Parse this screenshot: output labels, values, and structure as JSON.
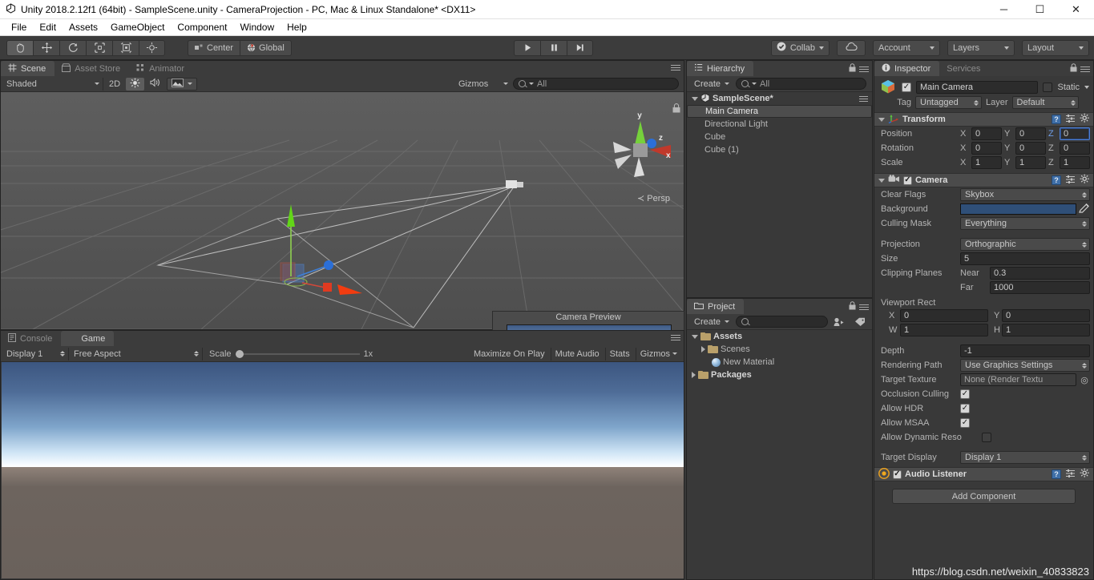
{
  "window": {
    "title": "Unity 2018.2.12f1 (64bit) - SampleScene.unity - CameraProjection - PC, Mac & Linux Standalone* <DX11>",
    "app_icon": "unity-logo-icon",
    "minimize": "─",
    "maximize": "☐",
    "close": "✕"
  },
  "menu": {
    "items": [
      "File",
      "Edit",
      "Assets",
      "GameObject",
      "Component",
      "Window",
      "Help"
    ]
  },
  "toolbar": {
    "transform_tools": [
      {
        "name": "hand-tool",
        "active": true
      },
      {
        "name": "move-tool",
        "active": false
      },
      {
        "name": "rotate-tool",
        "active": false
      },
      {
        "name": "scale-tool",
        "active": false
      },
      {
        "name": "rect-tool",
        "active": false
      },
      {
        "name": "transform-tool",
        "active": false
      }
    ],
    "pivot_label": "Center",
    "handle_label": "Global",
    "play_buttons": [
      {
        "name": "play-button",
        "glyph": "▶"
      },
      {
        "name": "pause-button",
        "glyph": "❙❙"
      },
      {
        "name": "step-button",
        "glyph": "▶❙"
      }
    ],
    "collab_label": "Collab",
    "cloud_icon": "cloud-icon",
    "account_label": "Account",
    "layers_label": "Layers",
    "layout_label": "Layout"
  },
  "scene_view": {
    "tabs": [
      {
        "label": "Scene",
        "icon": "grid-icon",
        "active": true
      },
      {
        "label": "Asset Store",
        "icon": "store-icon",
        "active": false
      },
      {
        "label": "Animator",
        "icon": "animator-icon",
        "active": false
      }
    ],
    "draw_mode": "Shaded",
    "mode_2d": "2D",
    "lighting_icon": "sun-icon",
    "audio_icon": "speaker-icon",
    "fx_icon": "image-icon",
    "gizmos_label": "Gizmos",
    "search_value": "All",
    "gizmo_axes": {
      "x": "x",
      "y": "y",
      "z": "z"
    },
    "projection_label": "Persp",
    "lock_icon": "lock-icon"
  },
  "camera_preview": {
    "title": "Camera Preview"
  },
  "game_view": {
    "tabs": [
      {
        "label": "Console",
        "icon": "console-icon",
        "active": false
      },
      {
        "label": "Game",
        "icon": "game-icon",
        "active": true
      }
    ],
    "display": "Display 1",
    "aspect": "Free Aspect",
    "scale_label": "Scale",
    "scale_value": "1x",
    "maximize_on_play": "Maximize On Play",
    "mute_audio": "Mute Audio",
    "stats": "Stats",
    "gizmos": "Gizmos"
  },
  "hierarchy": {
    "tab_label": "Hierarchy",
    "create_label": "Create",
    "search_value": "All",
    "scene_name": "SampleScene*",
    "objects": [
      {
        "label": "Main Camera",
        "selected": true
      },
      {
        "label": "Directional Light",
        "selected": false
      },
      {
        "label": "Cube",
        "selected": false
      },
      {
        "label": "Cube (1)",
        "selected": false
      }
    ]
  },
  "project": {
    "tab_label": "Project",
    "create_label": "Create",
    "search_value": "",
    "tree": [
      {
        "label": "Assets",
        "icon": "folder-icon",
        "depth": 0,
        "expanded": true,
        "bold": true
      },
      {
        "label": "Scenes",
        "icon": "folder-icon",
        "depth": 1,
        "expanded": false,
        "bold": false
      },
      {
        "label": "New Material",
        "icon": "material-icon",
        "depth": 1,
        "expanded": null,
        "bold": false
      },
      {
        "label": "Packages",
        "icon": "folder-icon",
        "depth": 0,
        "expanded": false,
        "bold": true
      }
    ]
  },
  "inspector": {
    "tabs": [
      {
        "label": "Inspector",
        "icon": "info-icon",
        "active": true
      },
      {
        "label": "Services",
        "icon": "",
        "active": false
      }
    ],
    "object_name": "Main Camera",
    "object_enabled": true,
    "static_label": "Static",
    "static_checked": false,
    "tag_label": "Tag",
    "tag_value": "Untagged",
    "layer_label": "Layer",
    "layer_value": "Default",
    "transform": {
      "title": "Transform",
      "rows": [
        {
          "label": "Position",
          "x": "0",
          "y": "0",
          "z": "0",
          "z_focused": true
        },
        {
          "label": "Rotation",
          "x": "0",
          "y": "0",
          "z": "0",
          "z_focused": false
        },
        {
          "label": "Scale",
          "x": "1",
          "y": "1",
          "z": "1",
          "z_focused": false
        }
      ]
    },
    "camera": {
      "title": "Camera",
      "enabled": true,
      "clear_flags_label": "Clear Flags",
      "clear_flags_value": "Skybox",
      "background_label": "Background",
      "background_color": "#2f4f78",
      "culling_mask_label": "Culling Mask",
      "culling_mask_value": "Everything",
      "projection_label": "Projection",
      "projection_value": "Orthographic",
      "size_label": "Size",
      "size_value": "5",
      "clipping_label": "Clipping Planes",
      "near_label": "Near",
      "near_value": "0.3",
      "far_label": "Far",
      "far_value": "1000",
      "viewport_label": "Viewport Rect",
      "viewport_x_label": "X",
      "viewport_x": "0",
      "viewport_y_label": "Y",
      "viewport_y": "0",
      "viewport_w_label": "W",
      "viewport_w": "1",
      "viewport_h_label": "H",
      "viewport_h": "1",
      "depth_label": "Depth",
      "depth_value": "-1",
      "rendering_path_label": "Rendering Path",
      "rendering_path_value": "Use Graphics Settings",
      "target_texture_label": "Target Texture",
      "target_texture_value": "None (Render Textu",
      "occlusion_label": "Occlusion Culling",
      "occlusion_checked": true,
      "hdr_label": "Allow HDR",
      "hdr_checked": true,
      "msaa_label": "Allow MSAA",
      "msaa_checked": true,
      "dynres_label": "Allow Dynamic Reso",
      "dynres_checked": false,
      "target_display_label": "Target Display",
      "target_display_value": "Display 1"
    },
    "audio_listener": {
      "title": "Audio Listener",
      "enabled": true
    },
    "add_component_label": "Add Component"
  },
  "watermark": "https://blog.csdn.net/weixin_40833823"
}
